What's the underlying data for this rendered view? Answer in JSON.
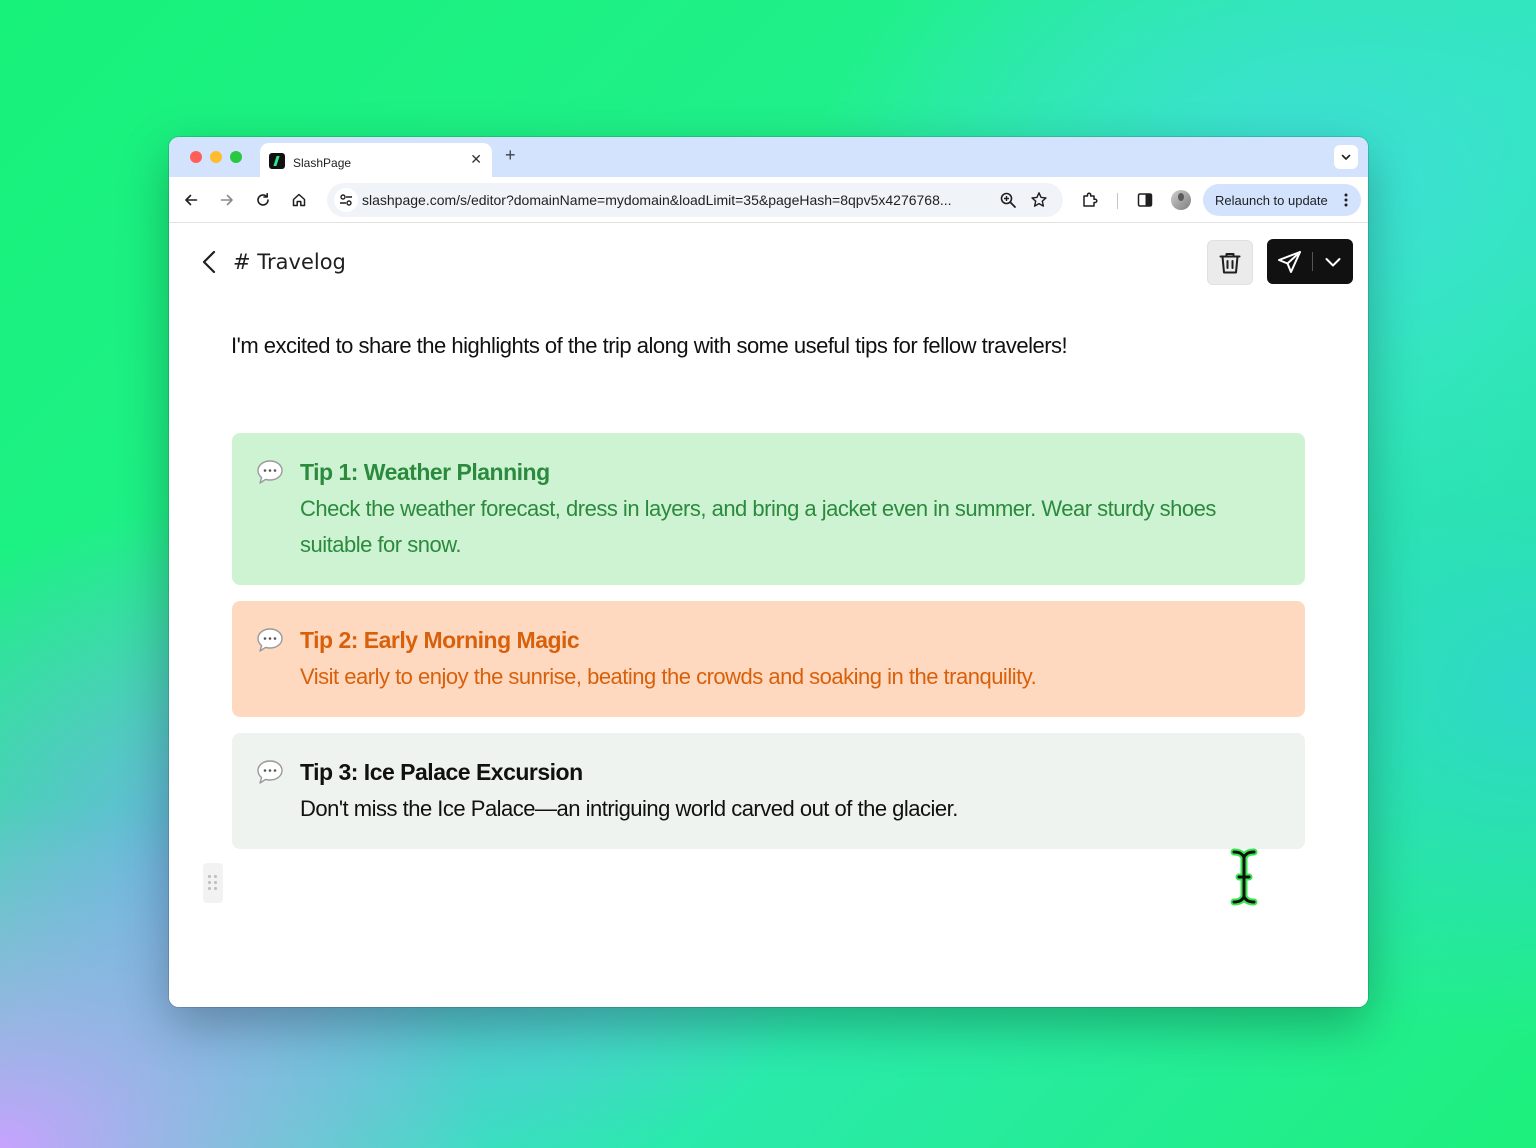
{
  "browser": {
    "tab": {
      "title": "SlashPage",
      "close_glyph": "✕"
    },
    "new_tab_glyph": "+",
    "url": "slashpage.com/s/editor?domainName=mydomain&loadLimit=35&pageHash=8qpv5x4276768...",
    "relaunch_label": "Relaunch to update",
    "icons": [
      "back-icon",
      "forward-icon",
      "reload-icon",
      "home-icon",
      "site-settings-icon",
      "zoom-icon",
      "bookmark-star-icon",
      "extensions-icon",
      "side-panel-icon",
      "profile-avatar",
      "kebab-menu-icon",
      "tab-search-chevron-icon"
    ]
  },
  "editor": {
    "page_title": "# Travelog",
    "intro": "I'm excited to share the highlights of the trip along with some useful tips for fellow travelers!",
    "callouts": [
      {
        "title": "Tip 1: Weather Planning",
        "body": "Check the weather forecast, dress in layers, and bring a jacket even in summer. Wear sturdy shoes suitable for snow.",
        "color": "#2b8a3e",
        "background": "#cef3d2"
      },
      {
        "title": "Tip 2: Early Morning Magic",
        "body": "Visit early to enjoy the sunrise, beating the crowds and soaking in the tranquility.",
        "color": "#d9600b",
        "background": "#fed9c0"
      },
      {
        "title": "Tip 3: Ice Palace Excursion",
        "body": "Don't miss the Ice Palace—an intriguing world carved out of the glacier.",
        "color": "#111111",
        "background": "#eef3ef"
      }
    ],
    "icons": [
      "back-chevron-icon",
      "trash-icon",
      "send-icon",
      "chevron-down-icon",
      "speech-bubble-icon",
      "drag-handle-icon"
    ]
  }
}
